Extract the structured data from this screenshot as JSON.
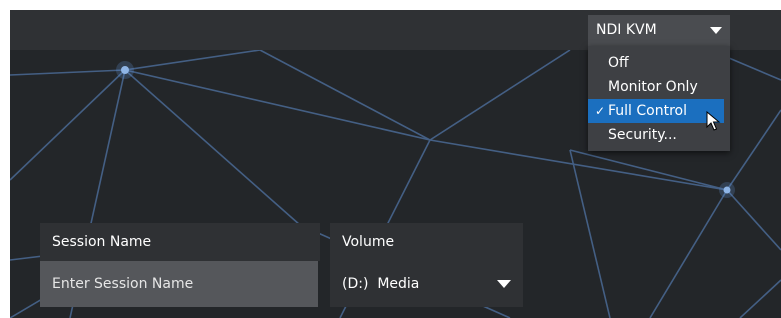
{
  "colors": {
    "background": "#232629",
    "topbar": "#2f3134",
    "menu": "#3e4044",
    "selected": "#1b6fbf",
    "input": "#55575b",
    "network_lines": "#4a6a95"
  },
  "header": {
    "kvm_dropdown": {
      "value": "NDI KVM",
      "icon": "chevron-down-icon"
    }
  },
  "kvm_menu": {
    "items": [
      {
        "label": "Off",
        "selected": false
      },
      {
        "label": "Monitor Only",
        "selected": false
      },
      {
        "label": "Full Control",
        "selected": true,
        "check": "✓"
      },
      {
        "label": "Security...",
        "selected": false
      }
    ]
  },
  "form": {
    "session_label": "Session Name",
    "session_placeholder": "Enter Session Name",
    "volume_label": "Volume",
    "volume_value": "(D:)  Media"
  }
}
